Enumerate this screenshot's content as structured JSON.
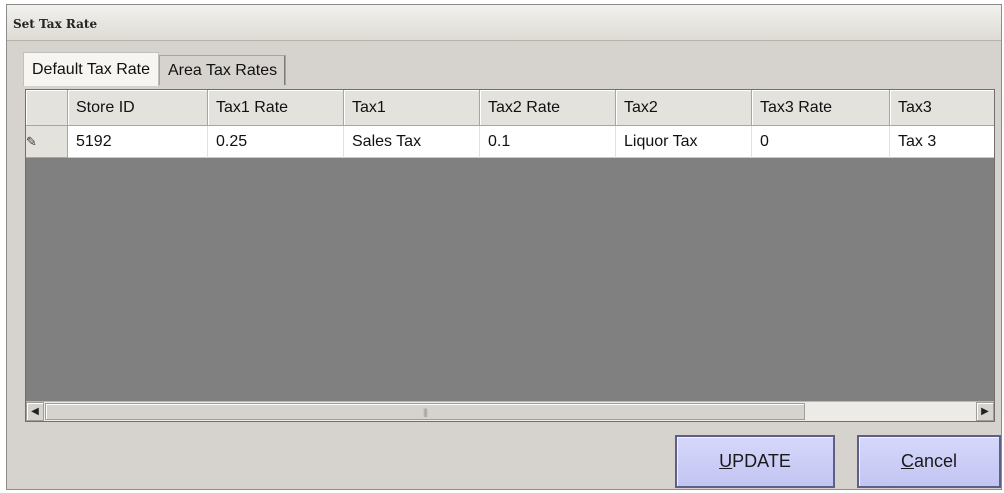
{
  "window": {
    "title": "Set Tax Rate"
  },
  "tabs": [
    {
      "label": "Default Tax Rate",
      "active": true
    },
    {
      "label": "Area Tax Rates",
      "active": false
    }
  ],
  "grid": {
    "columns": [
      "",
      "Store ID",
      "Tax1 Rate",
      "Tax1",
      "Tax2 Rate",
      "Tax2",
      "Tax3 Rate",
      "Tax3"
    ],
    "rows": [
      {
        "indicator": "pencil-icon",
        "indicator_glyph": "✎",
        "cells": [
          "5192",
          "0.25",
          "Sales Tax",
          "0.1",
          "Liquor Tax",
          "0",
          "Tax 3"
        ]
      }
    ],
    "background_color": "#808080"
  },
  "scrollbar": {
    "left_arrow": "◀",
    "right_arrow": "▶",
    "thumb_grip": "|||"
  },
  "buttons": {
    "update_accesskey": "U",
    "update_rest": "PDATE",
    "cancel_accesskey": "C",
    "cancel_rest": "ancel",
    "button_color": "#c9cbf6"
  }
}
